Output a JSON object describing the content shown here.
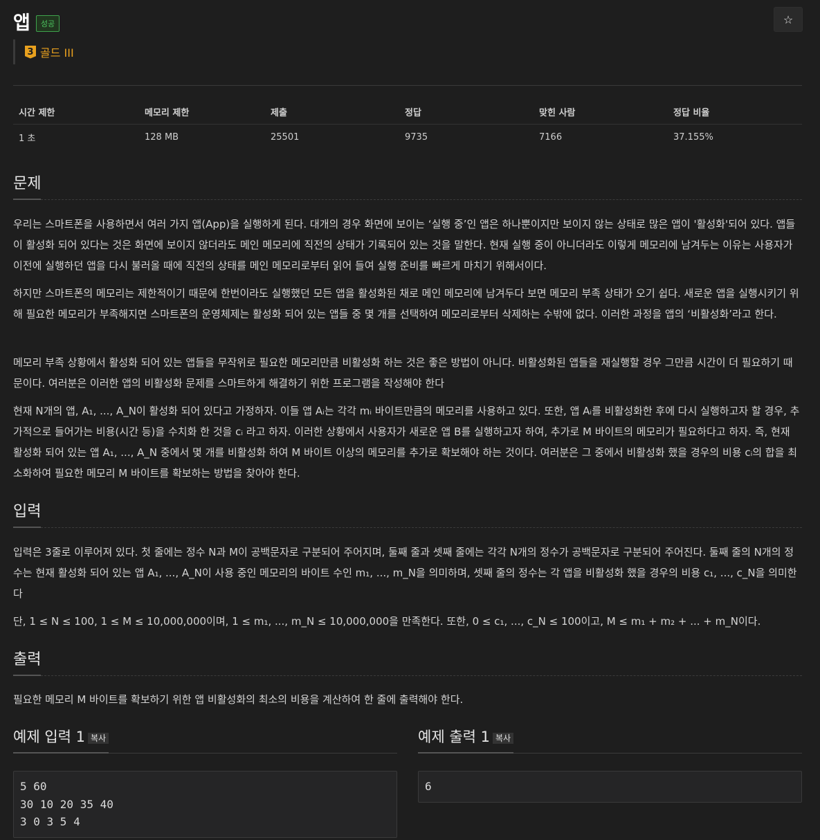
{
  "header": {
    "title": "앱",
    "status_badge": "성공",
    "tier_number": "3",
    "tier_label": "골드 III",
    "star_icon": "☆"
  },
  "info_table": {
    "headers": [
      "시간 제한",
      "메모리 제한",
      "제출",
      "정답",
      "맞힌 사람",
      "정답 비율"
    ],
    "values": [
      "1 초",
      "128 MB",
      "25501",
      "9735",
      "7166",
      "37.155%"
    ]
  },
  "sections": {
    "problem": {
      "title": "문제",
      "p1": "우리는 스마트폰을 사용하면서 여러 가지 앱(App)을 실행하게 된다. 대개의 경우 화면에 보이는 ‘실행 중’인 앱은 하나뿐이지만 보이지 않는 상태로 많은 앱이 '활성화'되어 있다. 앱들이 활성화 되어 있다는 것은 화면에 보이지 않더라도 메인 메모리에 직전의 상태가 기록되어 있는 것을 말한다. 현재 실행 중이 아니더라도 이렇게 메모리에 남겨두는 이유는 사용자가 이전에 실행하던 앱을 다시 불러올 때에 직전의 상태를 메인 메모리로부터 읽어 들여 실행 준비를 빠르게 마치기 위해서이다.",
      "p2": "하지만 스마트폰의 메모리는 제한적이기 때문에 한번이라도 실행했던 모든 앱을 활성화된 채로 메인 메모리에 남겨두다 보면 메모리 부족 상태가 오기 쉽다. 새로운 앱을 실행시키기 위해 필요한 메모리가 부족해지면 스마트폰의 운영체제는 활성화 되어 있는 앱들 중 몇 개를 선택하여 메모리로부터 삭제하는 수밖에 없다. 이러한 과정을 앱의 ‘비활성화’라고 한다.",
      "p3": "메모리 부족 상황에서 활성화 되어 있는 앱들을 무작위로 필요한 메모리만큼 비활성화 하는 것은 좋은 방법이 아니다. 비활성화된 앱들을 재실행할 경우 그만큼 시간이 더 필요하기 때문이다. 여러분은 이러한 앱의 비활성화 문제를 스마트하게 해결하기 위한 프로그램을 작성해야 한다",
      "p4": "현재 N개의 앱, A₁, ..., A_N이 활성화 되어 있다고 가정하자. 이들 앱 Aᵢ는 각각 mᵢ 바이트만큼의 메모리를 사용하고 있다. 또한, 앱 Aᵢ를 비활성화한 후에 다시 실행하고자 할 경우, 추가적으로 들어가는 비용(시간 등)을 수치화 한 것을 cᵢ 라고 하자. 이러한 상황에서 사용자가 새로운 앱 B를 실행하고자 하여, 추가로 M 바이트의 메모리가 필요하다고 하자. 즉, 현재 활성화 되어 있는 앱 A₁, ..., A_N 중에서 몇 개를 비활성화 하여 M 바이트 이상의 메모리를 추가로 확보해야 하는 것이다. 여러분은 그 중에서 비활성화 했을 경우의 비용 cᵢ의 합을 최소화하여 필요한 메모리 M 바이트를 확보하는 방법을 찾아야 한다."
    },
    "input": {
      "title": "입력",
      "p1": "입력은 3줄로 이루어져 있다. 첫 줄에는 정수 N과 M이 공백문자로 구분되어 주어지며, 둘째 줄과 셋째 줄에는 각각 N개의 정수가 공백문자로 구분되어 주어진다. 둘째 줄의 N개의 정수는 현재 활성화 되어 있는 앱 A₁, ..., A_N이 사용 중인 메모리의 바이트 수인 m₁, ..., m_N을 의미하며, 셋째 줄의 정수는 각 앱을 비활성화 했을 경우의 비용 c₁, ..., c_N을 의미한다",
      "p2": "단, 1 ≤ N ≤ 100, 1 ≤ M ≤ 10,000,000이며, 1 ≤ m₁, ..., m_N ≤ 10,000,000을 만족한다. 또한, 0 ≤ c₁, ..., c_N ≤ 100이고, M ≤ m₁ + m₂ + ... + m_N이다."
    },
    "output": {
      "title": "출력",
      "p1": "필요한 메모리 M 바이트를 확보하기 위한 앱 비활성화의 최소의 비용을 계산하여 한 줄에 출력해야 한다."
    }
  },
  "samples": {
    "input_title": "예제 입력 1",
    "output_title": "예제 출력 1",
    "copy_label": "복사",
    "input_text": "5 60\n30 10 20 35 40\n3 0 3 5 4",
    "output_text": "6"
  }
}
